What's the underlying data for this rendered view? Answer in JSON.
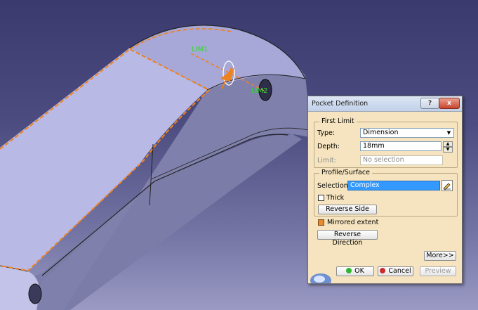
{
  "viewport": {
    "limit_labels": [
      "LIM1",
      "LIM2"
    ],
    "colors": {
      "background": "#3a3a6e",
      "part": "#b9b9e6",
      "preview": "#f0821e",
      "label": "#3bd23b"
    }
  },
  "dialog": {
    "title": "Pocket Definition",
    "help_label": "?",
    "close_label": "x",
    "first_limit": {
      "legend": "First Limit",
      "type_label": "Type:",
      "type_value": "Dimension",
      "depth_label": "Depth:",
      "depth_value": "18mm",
      "limit_label": "Limit:",
      "limit_value": "No selection"
    },
    "profile": {
      "legend": "Profile/Surface",
      "selection_label": "Selection:",
      "selection_value": "Complex",
      "thick_label": "Thick",
      "thick_checked": false,
      "reverse_side_label": "Reverse Side"
    },
    "mirrored_label": "Mirrored extent",
    "mirrored_checked": true,
    "reverse_direction_label": "Reverse Direction",
    "more_label": "More>>",
    "ok_label": "OK",
    "cancel_label": "Cancel",
    "preview_label": "Preview"
  }
}
